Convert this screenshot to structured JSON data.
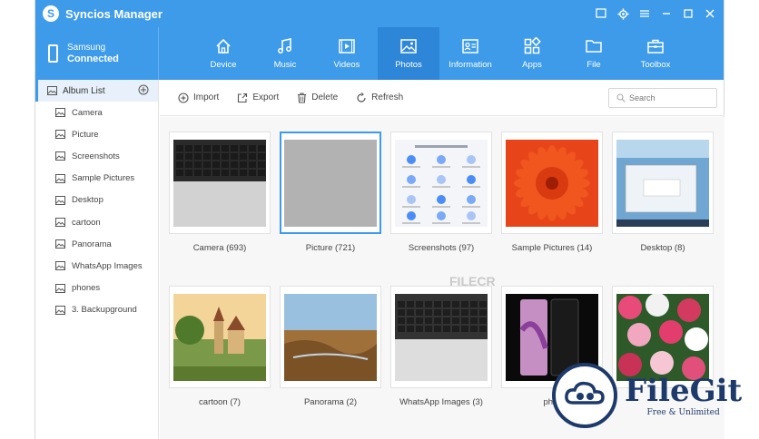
{
  "app": {
    "title": "Syncios Manager"
  },
  "device": {
    "name": "Samsung",
    "status": "Connected"
  },
  "tabs": [
    {
      "label": "Device",
      "icon": "home-icon"
    },
    {
      "label": "Music",
      "icon": "music-icon"
    },
    {
      "label": "Videos",
      "icon": "video-icon"
    },
    {
      "label": "Photos",
      "icon": "photo-icon",
      "active": true
    },
    {
      "label": "Information",
      "icon": "contact-card-icon"
    },
    {
      "label": "Apps",
      "icon": "apps-icon"
    },
    {
      "label": "File",
      "icon": "folder-icon"
    },
    {
      "label": "Toolbox",
      "icon": "toolbox-icon"
    }
  ],
  "sidebar": {
    "header": "Album List",
    "items": [
      {
        "label": "Camera"
      },
      {
        "label": "Picture"
      },
      {
        "label": "Screenshots"
      },
      {
        "label": "Sample Pictures"
      },
      {
        "label": "Desktop"
      },
      {
        "label": "cartoon"
      },
      {
        "label": "Panorama"
      },
      {
        "label": "WhatsApp Images"
      },
      {
        "label": "phones"
      },
      {
        "label": "3. Backupground"
      }
    ]
  },
  "toolbar": {
    "import": "Import",
    "export": "Export",
    "delete": "Delete",
    "refresh": "Refresh",
    "search_placeholder": "Search"
  },
  "albums": [
    {
      "label": "Camera (693)",
      "thumb": "keyboard"
    },
    {
      "label": "Picture (721)",
      "thumb": "gray",
      "selected": true
    },
    {
      "label": "Screenshots (97)",
      "thumb": "settings"
    },
    {
      "label": "Sample Pictures (14)",
      "thumb": "flower"
    },
    {
      "label": "Desktop (8)",
      "thumb": "desktop"
    },
    {
      "label": "cartoon (7)",
      "thumb": "castle"
    },
    {
      "label": "Panorama (2)",
      "thumb": "landscape"
    },
    {
      "label": "WhatsApp Images (3)",
      "thumb": "keyboard2"
    },
    {
      "label": "phor",
      "thumb": "phone"
    },
    {
      "label": "",
      "thumb": "flowers"
    }
  ],
  "watermarks": {
    "filecr": "FILECR",
    "filegit_name": "FileGit",
    "filegit_tag": "Free & Unlimited"
  },
  "colors": {
    "accent": "#3d9be9",
    "accent_dark": "#2e86d8",
    "brand_dark": "#1e3a6b"
  }
}
